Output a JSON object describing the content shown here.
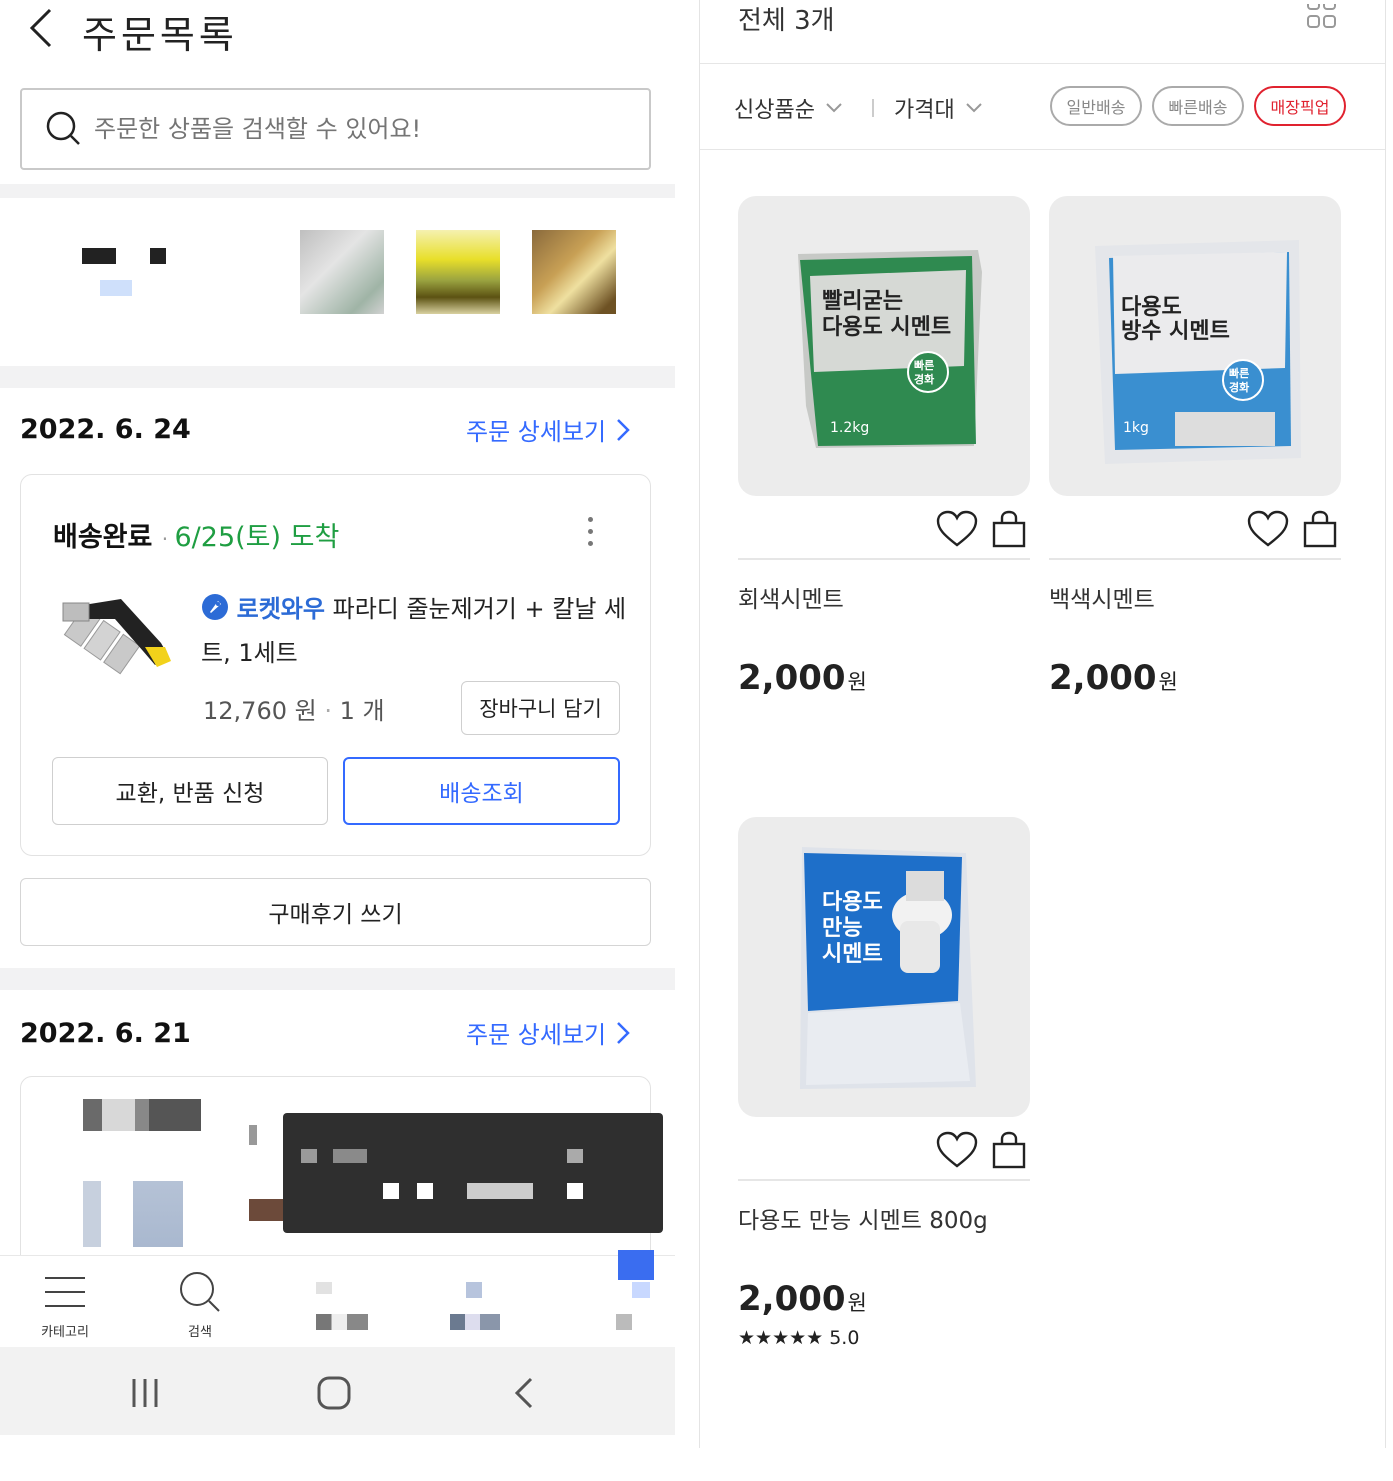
{
  "left": {
    "header_title": "주문목록",
    "search_placeholder": "주문한 상품을 검색할 수 있어요!",
    "orders": [
      {
        "date": "2022. 6. 24",
        "detail_link": "주문 상세보기",
        "status": "배송완료",
        "arrival": "6/25(토) 도착",
        "badge": "로켓와우",
        "product_name": "파라디 줄눈제거기 + 칼날 세트, 1세트",
        "price": "12,760 원",
        "qty": "1 개",
        "cart_button": "장바구니 담기",
        "exchange_button": "교환, 반품 신청",
        "tracking_button": "배송조회",
        "review_button": "구매후기 쓰기"
      },
      {
        "date": "2022. 6. 21",
        "detail_link": "주문 상세보기"
      }
    ],
    "tabbar": [
      {
        "label": "카테고리",
        "icon": "menu-icon"
      },
      {
        "label": "검색",
        "icon": "search-icon"
      }
    ]
  },
  "right": {
    "count_label": "전체 3개",
    "sort_label": "신상품순",
    "price_filter_label": "가격대",
    "chips": [
      "일반배송",
      "빠른배송",
      "매장픽업"
    ],
    "products": [
      {
        "name": "회색시멘트",
        "price": "2,000",
        "unit": "원",
        "package_title": "빨리굳는 다용도 시멘트",
        "package_badge": "빠른 경화",
        "package_weight": "1.2kg",
        "package_color": "#2f8a50"
      },
      {
        "name": "백색시멘트",
        "price": "2,000",
        "unit": "원",
        "package_title": "다용도 방수 시멘트",
        "package_badge": "빠른 경화",
        "package_weight": "1kg",
        "package_color": "#3a8fd0"
      },
      {
        "name": "다용도 만능 시멘트 800g",
        "price": "2,000",
        "unit": "원",
        "package_title": "다용도 만능 시멘트",
        "package_badge": "",
        "package_weight": "",
        "package_color": "#1e6fc9",
        "rating_stars": "★★★★★",
        "rating_value": "5.0"
      }
    ]
  },
  "colors": {
    "accent_blue": "#346aff",
    "arrival_green": "#1f9e42",
    "pickup_red": "#e0222f"
  }
}
